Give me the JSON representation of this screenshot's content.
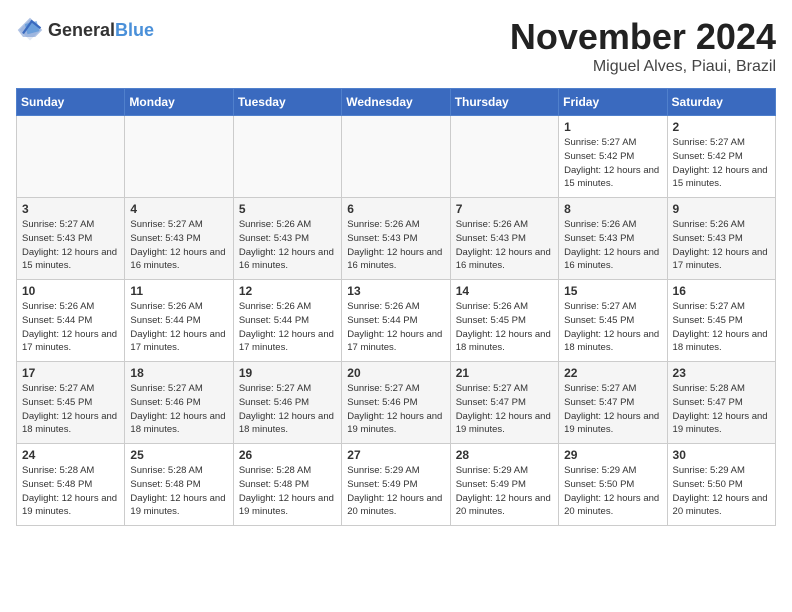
{
  "logo": {
    "text_general": "General",
    "text_blue": "Blue"
  },
  "header": {
    "month": "November 2024",
    "location": "Miguel Alves, Piaui, Brazil"
  },
  "weekdays": [
    "Sunday",
    "Monday",
    "Tuesday",
    "Wednesday",
    "Thursday",
    "Friday",
    "Saturday"
  ],
  "weeks": [
    [
      {
        "day": "",
        "info": ""
      },
      {
        "day": "",
        "info": ""
      },
      {
        "day": "",
        "info": ""
      },
      {
        "day": "",
        "info": ""
      },
      {
        "day": "",
        "info": ""
      },
      {
        "day": "1",
        "info": "Sunrise: 5:27 AM\nSunset: 5:42 PM\nDaylight: 12 hours\nand 15 minutes."
      },
      {
        "day": "2",
        "info": "Sunrise: 5:27 AM\nSunset: 5:42 PM\nDaylight: 12 hours\nand 15 minutes."
      }
    ],
    [
      {
        "day": "3",
        "info": "Sunrise: 5:27 AM\nSunset: 5:43 PM\nDaylight: 12 hours\nand 15 minutes."
      },
      {
        "day": "4",
        "info": "Sunrise: 5:27 AM\nSunset: 5:43 PM\nDaylight: 12 hours\nand 16 minutes."
      },
      {
        "day": "5",
        "info": "Sunrise: 5:26 AM\nSunset: 5:43 PM\nDaylight: 12 hours\nand 16 minutes."
      },
      {
        "day": "6",
        "info": "Sunrise: 5:26 AM\nSunset: 5:43 PM\nDaylight: 12 hours\nand 16 minutes."
      },
      {
        "day": "7",
        "info": "Sunrise: 5:26 AM\nSunset: 5:43 PM\nDaylight: 12 hours\nand 16 minutes."
      },
      {
        "day": "8",
        "info": "Sunrise: 5:26 AM\nSunset: 5:43 PM\nDaylight: 12 hours\nand 16 minutes."
      },
      {
        "day": "9",
        "info": "Sunrise: 5:26 AM\nSunset: 5:43 PM\nDaylight: 12 hours\nand 17 minutes."
      }
    ],
    [
      {
        "day": "10",
        "info": "Sunrise: 5:26 AM\nSunset: 5:44 PM\nDaylight: 12 hours\nand 17 minutes."
      },
      {
        "day": "11",
        "info": "Sunrise: 5:26 AM\nSunset: 5:44 PM\nDaylight: 12 hours\nand 17 minutes."
      },
      {
        "day": "12",
        "info": "Sunrise: 5:26 AM\nSunset: 5:44 PM\nDaylight: 12 hours\nand 17 minutes."
      },
      {
        "day": "13",
        "info": "Sunrise: 5:26 AM\nSunset: 5:44 PM\nDaylight: 12 hours\nand 17 minutes."
      },
      {
        "day": "14",
        "info": "Sunrise: 5:26 AM\nSunset: 5:45 PM\nDaylight: 12 hours\nand 18 minutes."
      },
      {
        "day": "15",
        "info": "Sunrise: 5:27 AM\nSunset: 5:45 PM\nDaylight: 12 hours\nand 18 minutes."
      },
      {
        "day": "16",
        "info": "Sunrise: 5:27 AM\nSunset: 5:45 PM\nDaylight: 12 hours\nand 18 minutes."
      }
    ],
    [
      {
        "day": "17",
        "info": "Sunrise: 5:27 AM\nSunset: 5:45 PM\nDaylight: 12 hours\nand 18 minutes."
      },
      {
        "day": "18",
        "info": "Sunrise: 5:27 AM\nSunset: 5:46 PM\nDaylight: 12 hours\nand 18 minutes."
      },
      {
        "day": "19",
        "info": "Sunrise: 5:27 AM\nSunset: 5:46 PM\nDaylight: 12 hours\nand 18 minutes."
      },
      {
        "day": "20",
        "info": "Sunrise: 5:27 AM\nSunset: 5:46 PM\nDaylight: 12 hours\nand 19 minutes."
      },
      {
        "day": "21",
        "info": "Sunrise: 5:27 AM\nSunset: 5:47 PM\nDaylight: 12 hours\nand 19 minutes."
      },
      {
        "day": "22",
        "info": "Sunrise: 5:27 AM\nSunset: 5:47 PM\nDaylight: 12 hours\nand 19 minutes."
      },
      {
        "day": "23",
        "info": "Sunrise: 5:28 AM\nSunset: 5:47 PM\nDaylight: 12 hours\nand 19 minutes."
      }
    ],
    [
      {
        "day": "24",
        "info": "Sunrise: 5:28 AM\nSunset: 5:48 PM\nDaylight: 12 hours\nand 19 minutes."
      },
      {
        "day": "25",
        "info": "Sunrise: 5:28 AM\nSunset: 5:48 PM\nDaylight: 12 hours\nand 19 minutes."
      },
      {
        "day": "26",
        "info": "Sunrise: 5:28 AM\nSunset: 5:48 PM\nDaylight: 12 hours\nand 19 minutes."
      },
      {
        "day": "27",
        "info": "Sunrise: 5:29 AM\nSunset: 5:49 PM\nDaylight: 12 hours\nand 20 minutes."
      },
      {
        "day": "28",
        "info": "Sunrise: 5:29 AM\nSunset: 5:49 PM\nDaylight: 12 hours\nand 20 minutes."
      },
      {
        "day": "29",
        "info": "Sunrise: 5:29 AM\nSunset: 5:50 PM\nDaylight: 12 hours\nand 20 minutes."
      },
      {
        "day": "30",
        "info": "Sunrise: 5:29 AM\nSunset: 5:50 PM\nDaylight: 12 hours\nand 20 minutes."
      }
    ]
  ]
}
